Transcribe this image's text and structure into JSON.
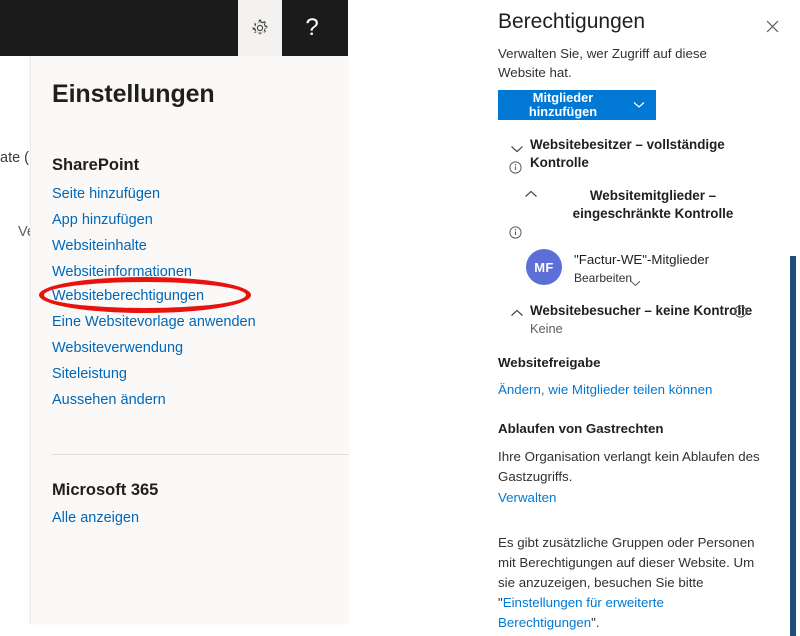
{
  "background_page": {
    "fragment_1": "ate (",
    "fragment_2": "Ve"
  },
  "topbar": {
    "gear_icon": "gear-icon",
    "help_label": "?"
  },
  "settings_panel": {
    "title": "Einstellungen",
    "sharepoint": {
      "heading": "SharePoint",
      "links": [
        "Seite hinzufügen",
        "App hinzufügen",
        "Websiteinhalte",
        "Websiteinformationen",
        "Websiteberechtigungen",
        "Eine Websitevorlage anwenden",
        "Websiteverwendung",
        "Siteleistung",
        "Aussehen ändern"
      ]
    },
    "microsoft365": {
      "heading": "Microsoft 365",
      "links": [
        "Alle anzeigen"
      ]
    },
    "annotation": {
      "shape": "ellipse",
      "color": "#e8120e",
      "target": "Websiteberechtigungen"
    }
  },
  "permissions_pane": {
    "title": "Berechtigungen",
    "close_label": "×",
    "subtitle": "Verwalten Sie, wer Zugriff auf diese Website hat.",
    "add_members_button": "Mitglieder hinzufügen",
    "groups": [
      {
        "name": "Websitebesitzer – vollständige Kontrolle",
        "expanded": true,
        "members": []
      },
      {
        "name": "Websitemitglieder – eingeschränkte Kontrolle",
        "expanded": false,
        "members": [
          {
            "initials": "MF",
            "name": "\"Factur-WE\"-Mitglieder",
            "role": "Bearbeiten",
            "avatar_color": "#5b6fd6"
          }
        ]
      },
      {
        "name": "Websitebesucher – keine Kontrolle",
        "expanded": false,
        "empty_label": "Keine",
        "members": []
      }
    ],
    "site_sharing": {
      "heading": "Websitefreigabe",
      "link": "Ändern, wie Mitglieder teilen können"
    },
    "guest_expiration": {
      "heading": "Ablaufen von Gastrechten",
      "body": "Ihre Organisation verlangt kein Ablaufen des Gastzugriffs.",
      "link": "Verwalten"
    },
    "footer": {
      "text_before": "Es gibt zusätzliche Gruppen oder Personen mit Berechtigungen auf dieser Website. Um sie anzuzeigen, besuchen Sie bitte \"",
      "link": "Einstellungen für erweiterte Berechtigungen",
      "text_after": "\"."
    },
    "scrollbar_color": "#1f4e79"
  }
}
